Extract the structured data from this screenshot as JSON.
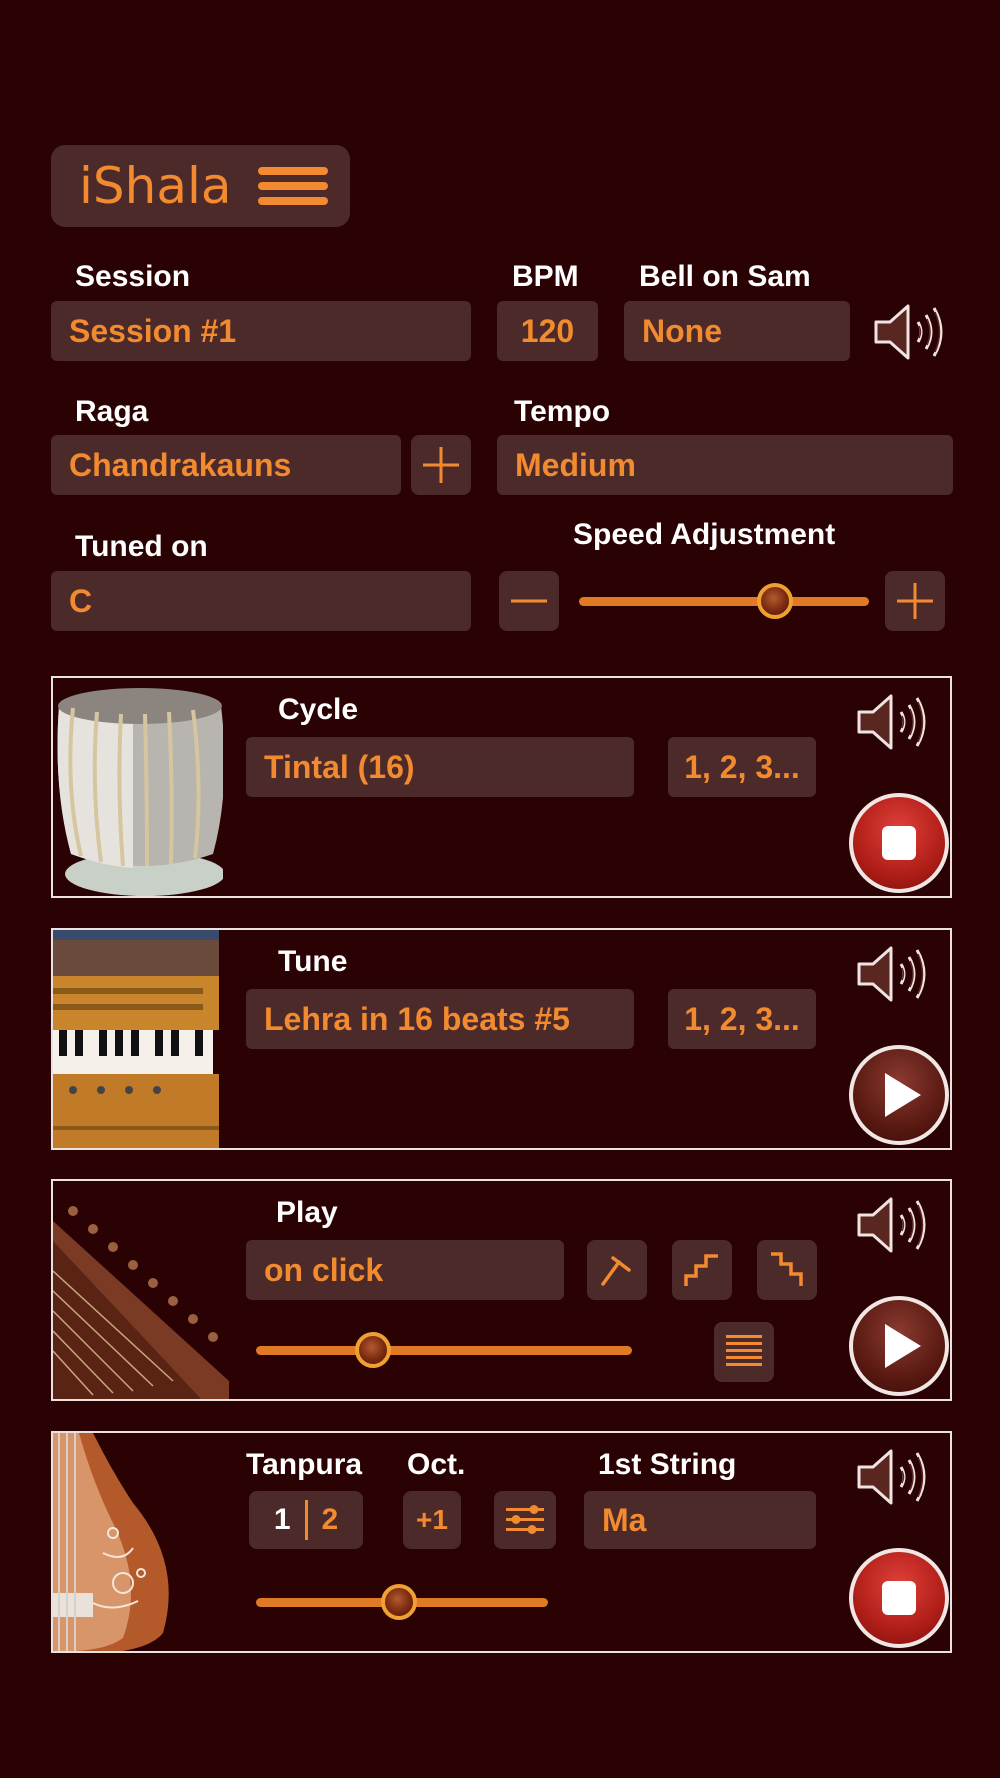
{
  "header": {
    "app_name": "iShala"
  },
  "session": {
    "label": "Session",
    "value": "Session #1"
  },
  "bpm": {
    "label": "BPM",
    "value": "120"
  },
  "bell": {
    "label": "Bell on Sam",
    "value": "None"
  },
  "raga": {
    "label": "Raga",
    "value": "Chandrakauns"
  },
  "tempo": {
    "label": "Tempo",
    "value": "Medium"
  },
  "tuned": {
    "label": "Tuned on",
    "value": "C"
  },
  "speed": {
    "label": "Speed Adjustment",
    "level": 0.7
  },
  "cycle_panel": {
    "label": "Cycle",
    "value": "Tintal (16)",
    "counter": "1, 2, 3...",
    "state": "playing"
  },
  "tune_panel": {
    "label": "Tune",
    "value": "Lehra in 16 beats #5",
    "counter": "1, 2, 3...",
    "state": "stopped"
  },
  "play_panel": {
    "label": "Play",
    "value": "on click",
    "level": 0.29,
    "state": "stopped"
  },
  "tanpura_panel": {
    "label": "Tanpura",
    "seg1": "1",
    "seg2": "2",
    "oct_label": "Oct.",
    "oct_value": "+1",
    "string_label": "1st String",
    "string_value": "Ma",
    "level": 0.49,
    "state": "playing"
  },
  "colors": {
    "background": "#2a0204",
    "field": "#4c2a2a",
    "accent": "#f28a30",
    "text": "#ffffff"
  },
  "icons": [
    "menu-icon",
    "speaker-icon",
    "plus-icon",
    "minus-icon",
    "stop-icon",
    "play-icon",
    "strike-icon",
    "stairs-up-icon",
    "stairs-down-icon",
    "list-icon",
    "mixer-icon"
  ]
}
